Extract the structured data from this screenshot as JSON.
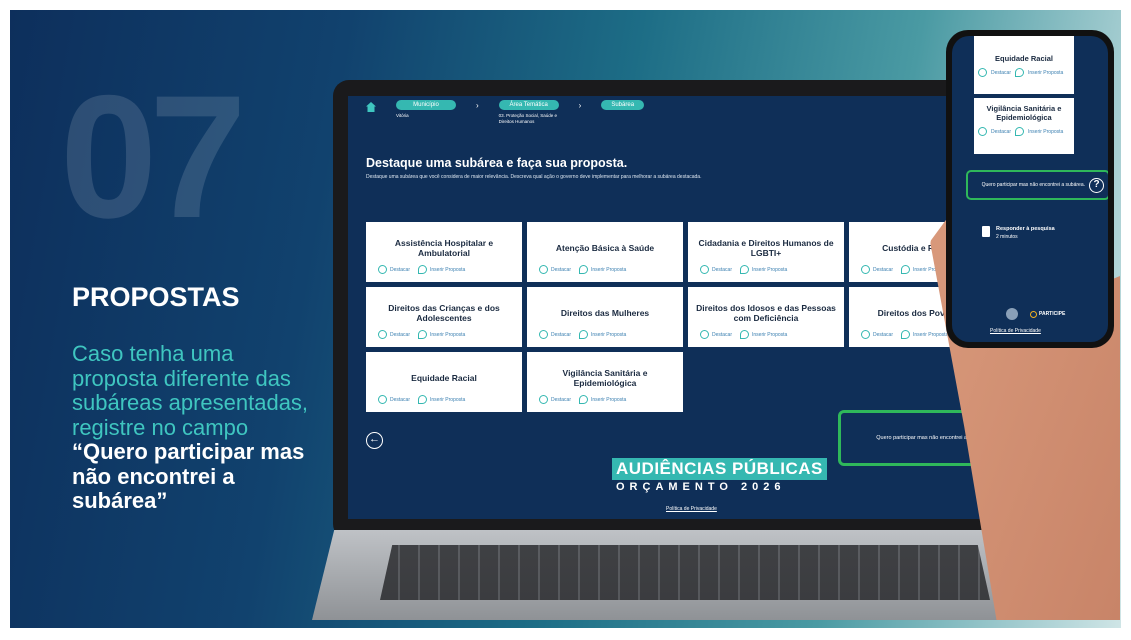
{
  "slide": {
    "number": "07",
    "title": "PROPOSTAS",
    "body": "Caso tenha uma proposta diferente das subáreas apresentadas, registre no campo",
    "body_strong": "“Quero participar mas não encontrei a subárea”"
  },
  "laptop": {
    "breadcrumb": [
      {
        "label": "Município",
        "sub": "Vitória"
      },
      {
        "label": "Área Temática",
        "sub": "03. Proteção Social, Saúde e Direitos Humanos"
      },
      {
        "label": "Subárea",
        "sub": ""
      }
    ],
    "heading": "Destaque uma subárea e faça sua proposta.",
    "description": "Destaque uma subárea que você considera de maior relevância. Descreva qual ação o governo deve implementar para melhorar a subárea destacada.",
    "action_highlight": "Destacar",
    "action_propose": "Inserir Proposta",
    "cards": [
      "Assistência Hospitalar e Ambulatorial",
      "Atenção Básica à Saúde",
      "Cidadania e Direitos Humanos de LGBTI+",
      "Custódia e Reintegraç",
      "Direitos das Crianças e dos Adolescentes",
      "Direitos das Mulheres",
      "Direitos dos Idosos e das Pessoas com Deficiência",
      "Direitos dos Pov Quilom",
      "Equidade Racial",
      "Vigilância Sanitária e Epidemiológica"
    ],
    "quero_text": "Quero participar mas não encontrei a subárea.",
    "logo_line1": "AUDIÊNCIAS PÚBLICAS",
    "logo_line2": "ORÇAMENTO 2026",
    "privacy": "Política de Privacidade"
  },
  "phone": {
    "cards": [
      "Equidade Racial",
      "Vigilância Sanitária e Epidemiológica"
    ],
    "action_highlight": "Destacar",
    "action_propose": "Inserir Proposta",
    "quero_text": "Quero participar mas não encontrei a subárea.",
    "survey_title": "Responder à pesquisa",
    "survey_time": "2 minutos",
    "brand": "PARTICIPE",
    "privacy": "Política de Privacidade"
  },
  "colors": {
    "navy": "#0f2f58",
    "teal": "#35b8b1",
    "green_border": "#2fb85a"
  }
}
